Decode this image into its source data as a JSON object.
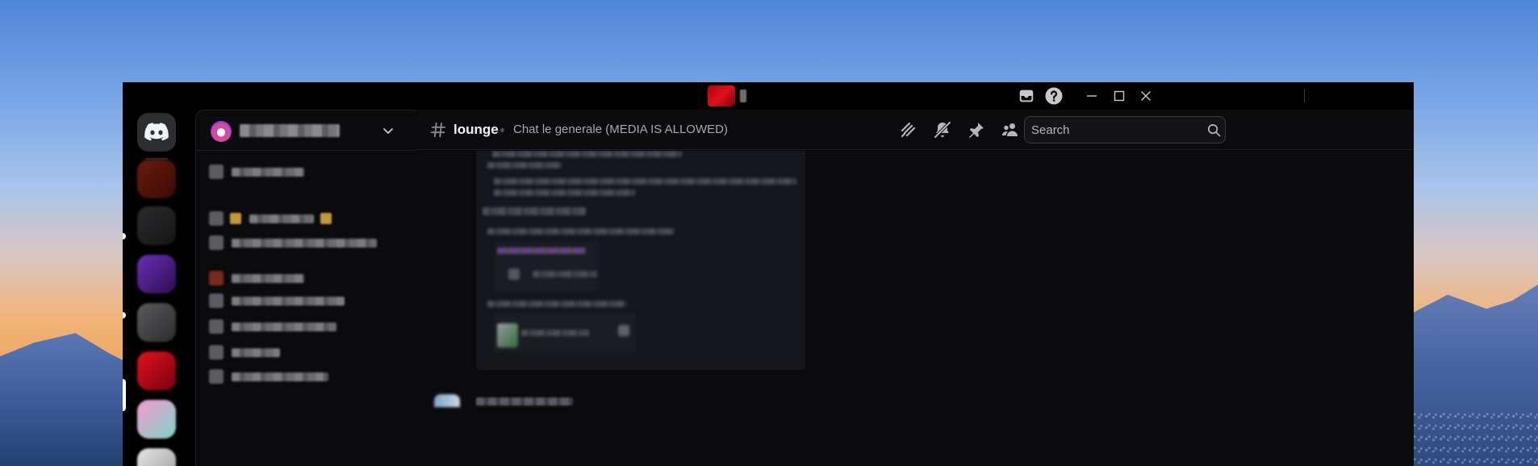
{
  "window": {
    "title_blurred": "",
    "controls": {
      "inbox_icon": "inbox-icon",
      "help_icon": "help-icon",
      "minimize_icon": "minimize-icon",
      "maximize_icon": "maximize-icon",
      "close_icon": "close-icon"
    }
  },
  "server_bar": {
    "home_icon": "discord-logo-icon",
    "servers": [
      {
        "color_a": "#6b1a0e",
        "color_b": "#3a0b05"
      },
      {
        "color_a": "#2b2b2e",
        "color_b": "#151517"
      },
      {
        "color_a": "#6a2fb8",
        "color_b": "#2a0f4d"
      },
      {
        "color_a": "#5a5a5e",
        "color_b": "#2c2c2f"
      },
      {
        "color_a": "#e0121c",
        "color_b": "#7a0010"
      },
      {
        "color_a": "#f59bd0",
        "color_b": "#7ed4c6"
      },
      {
        "color_a": "#e6e6e6",
        "color_b": "#9a9a9a"
      }
    ]
  },
  "guild": {
    "name_blurred": ""
  },
  "channels": [
    {
      "kind": "text",
      "width": 90
    },
    {
      "kind": "emoji",
      "width": 80
    },
    {
      "kind": "text",
      "width": 180
    },
    {
      "kind": "category",
      "width": 90
    },
    {
      "kind": "text",
      "width": 140
    },
    {
      "kind": "text",
      "width": 130
    },
    {
      "kind": "text",
      "width": 60
    },
    {
      "kind": "text",
      "width": 120
    }
  ],
  "channel_header": {
    "name": "lounge",
    "topic": "Chat le generale (MEDIA IS ALLOWED)",
    "icons": [
      "threads-icon",
      "mute-bell-icon",
      "pin-icon",
      "members-icon"
    ]
  },
  "search": {
    "placeholder": "Search"
  },
  "colors": {
    "window_bg": "#000000",
    "panel_bg": "#0b0b0d",
    "embed_bg": "#15171c",
    "text_primary": "#f2f3f5",
    "text_muted": "#a8a9ae"
  }
}
